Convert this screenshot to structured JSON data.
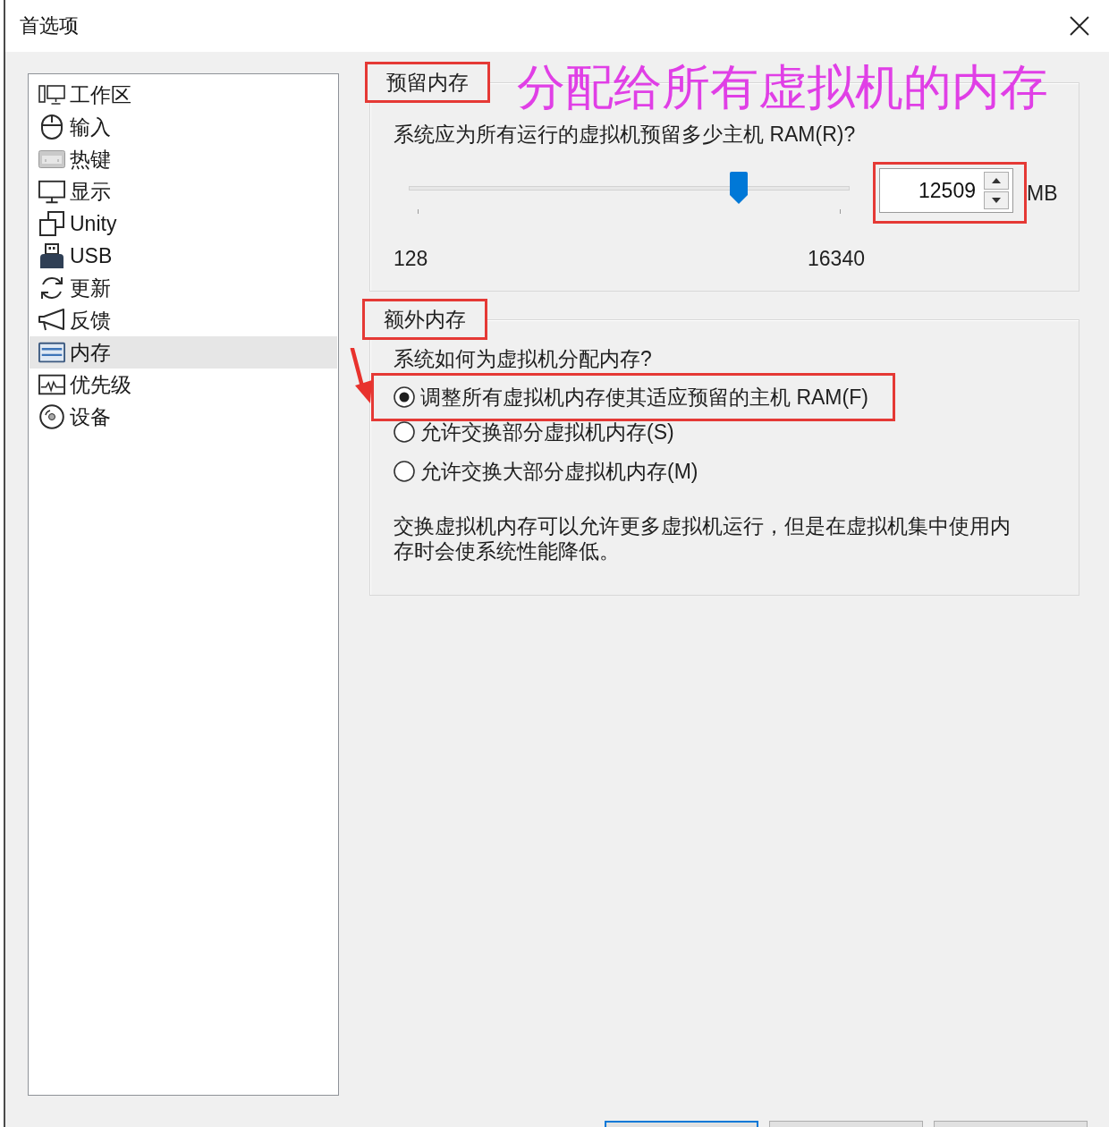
{
  "window": {
    "title": "首选项"
  },
  "sidebar": {
    "items": [
      {
        "label": "工作区",
        "kind": "workspace",
        "selected": false
      },
      {
        "label": "输入",
        "kind": "input",
        "selected": false
      },
      {
        "label": "热键",
        "kind": "hotkeys",
        "selected": false
      },
      {
        "label": "显示",
        "kind": "display",
        "selected": false
      },
      {
        "label": "Unity",
        "kind": "unity",
        "selected": false
      },
      {
        "label": "USB",
        "kind": "usb",
        "selected": false
      },
      {
        "label": "更新",
        "kind": "updates",
        "selected": false
      },
      {
        "label": "反馈",
        "kind": "feedback",
        "selected": false
      },
      {
        "label": "内存",
        "kind": "memory",
        "selected": true
      },
      {
        "label": "优先级",
        "kind": "priority",
        "selected": false
      },
      {
        "label": "设备",
        "kind": "devices",
        "selected": false
      }
    ]
  },
  "reserved_memory": {
    "legend": "预留内存",
    "legend_highlighted": true,
    "annotation": "分配给所有虚拟机的内存",
    "question": "系统应为所有运行的虚拟机预留多少主机 RAM(R)?",
    "slider": {
      "level": 0.76,
      "min_label": "128",
      "max_label": "16340"
    },
    "amount": {
      "value": "12509",
      "highlighted": true
    },
    "unit": "MB"
  },
  "additional_memory": {
    "legend": "额外内存",
    "legend_highlighted": true,
    "question": "系统如何为虚拟机分配内存?",
    "options": [
      {
        "label": "调整所有虚拟机内存使其适应预留的主机 RAM(F)",
        "selected": true,
        "highlighted": true,
        "arrow": true
      },
      {
        "label": "允许交换部分虚拟机内存(S)",
        "selected": false,
        "highlighted": false,
        "arrow": false
      },
      {
        "label": "允许交换大部分虚拟机内存(M)",
        "selected": false,
        "highlighted": false,
        "arrow": false
      }
    ],
    "note": "交换虚拟机内存可以允许更多虚拟机运行，但是在虚拟机集中使用内存时会使系统性能降低。"
  },
  "buttons": [
    {
      "default": true
    },
    {
      "default": false
    },
    {
      "default": false
    }
  ]
}
